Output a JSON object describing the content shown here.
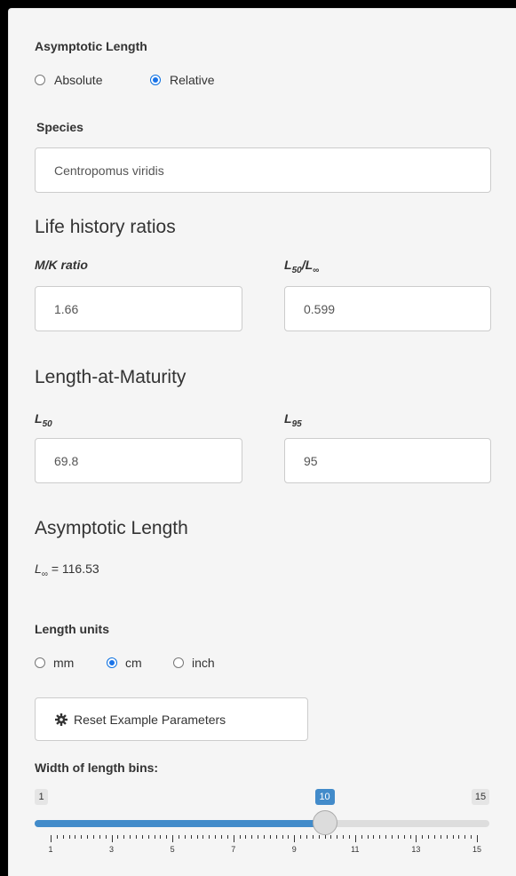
{
  "asymptotic_section": {
    "label": "Asymptotic Length",
    "options": [
      "Absolute",
      "Relative"
    ],
    "selected": "Relative"
  },
  "species": {
    "label": "Species",
    "value": "Centropomus viridis"
  },
  "ratios": {
    "heading": "Life history ratios",
    "mk_label": "M/K ratio",
    "mk_value": "1.66",
    "l50_linf_label_main": "L",
    "l50_linf_label_sub": "50",
    "l50_linf_label_rest": "/L",
    "l50_linf_label_inf": "∞",
    "l50_linf_value": "0.599"
  },
  "maturity": {
    "heading": "Length-at-Maturity",
    "l50_label": "L",
    "l50_sub": "50",
    "l50_value": "69.8",
    "l95_label": "L",
    "l95_sub": "95",
    "l95_value": "95"
  },
  "asymptotic_result": {
    "heading": "Asymptotic Length",
    "linf_label": "L",
    "linf_sub": "∞",
    "linf_text": " = 116.53"
  },
  "units": {
    "label": "Length units",
    "options": [
      "mm",
      "cm",
      "inch"
    ],
    "selected": "cm"
  },
  "reset_button": {
    "label": "Reset Example Parameters",
    "icon": "gear-icon"
  },
  "slider": {
    "label": "Width of length bins:",
    "min": 1,
    "max": 15,
    "value": 10,
    "min_label": "1",
    "max_label": "15",
    "value_label": "10",
    "tick_labels": [
      "1",
      "3",
      "5",
      "7",
      "9",
      "11",
      "13",
      "15"
    ],
    "accent": "#428bca"
  }
}
